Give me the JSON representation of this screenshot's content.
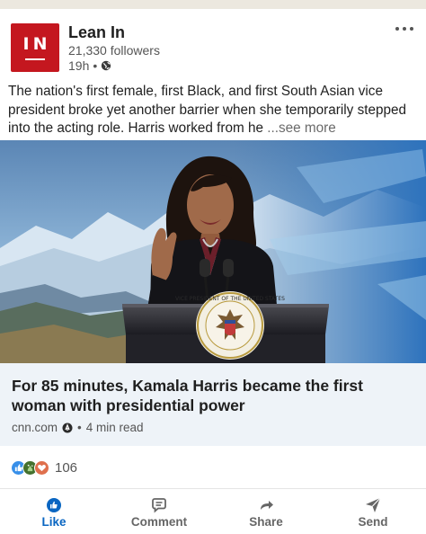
{
  "post": {
    "author": {
      "name": "Lean In",
      "logo_text": "IN",
      "followers": "21,330 followers",
      "time": "19h",
      "separator": "•",
      "visibility_icon": "globe-icon"
    },
    "more_icon": "ellipsis-icon",
    "text": "The nation's first female, first Black, and first South Asian vice president broke yet another barrier when she temporarily stepped into the acting role. Harris worked from he",
    "see_more": "...see more",
    "image": {
      "caption_elements": "vice-president-at-podium",
      "seal_text": "VICE PRESIDENT OF THE UNITED STATES"
    },
    "article": {
      "title": "For 85 minutes, Kamala Harris became the first woman with presidential power",
      "source": "cnn.com",
      "separator": "•",
      "read_time": "4 min read"
    },
    "reactions": {
      "icons": [
        "like-icon",
        "celebrate-icon",
        "love-icon"
      ],
      "count": "106"
    },
    "actions": {
      "like": "Like",
      "comment": "Comment",
      "share": "Share",
      "send": "Send"
    }
  },
  "colors": {
    "brand_red": "#c4171f",
    "like_blue": "#0a66c2",
    "article_bg": "#eef3f8"
  }
}
